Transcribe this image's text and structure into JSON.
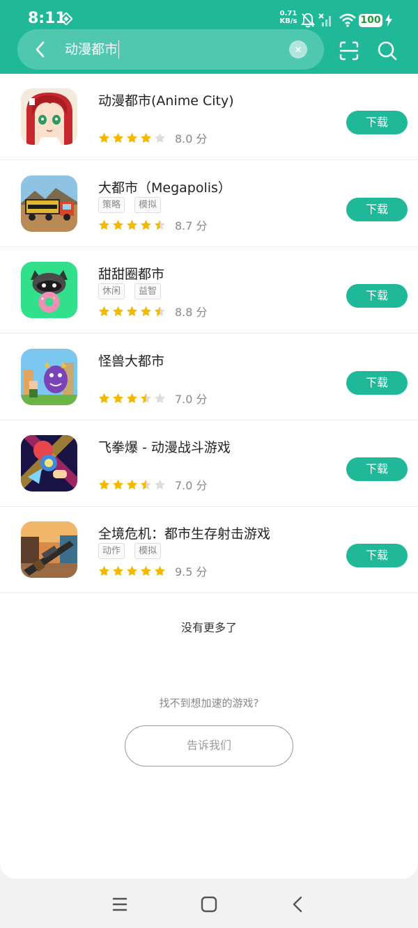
{
  "status": {
    "time": "8:11",
    "speed_value": "0.71",
    "speed_unit": "KB/s",
    "battery": "100"
  },
  "search": {
    "query": "动漫都市"
  },
  "apps": [
    {
      "name": "动漫都市(Anime City)",
      "tags": [],
      "rating": 4,
      "score": "8.0 分",
      "download_label": "下载",
      "icon": "anime-girl-icon"
    },
    {
      "name": "大都市（Megapolis）",
      "tags": [
        "策略",
        "模拟"
      ],
      "rating": 4.5,
      "score": "8.7 分",
      "download_label": "下载",
      "icon": "megapolis-truck-icon"
    },
    {
      "name": "甜甜圈都市",
      "tags": [
        "休闲",
        "益智"
      ],
      "rating": 4.5,
      "score": "8.8 分",
      "download_label": "下载",
      "icon": "raccoon-donut-icon"
    },
    {
      "name": "怪兽大都市",
      "tags": [],
      "rating": 3.5,
      "score": "7.0 分",
      "download_label": "下载",
      "icon": "monster-city-icon"
    },
    {
      "name": "飞拳爆 - 动漫战斗游戏",
      "tags": [],
      "rating": 3.5,
      "score": "7.0 分",
      "download_label": "下载",
      "icon": "flying-fist-icon"
    },
    {
      "name": "全境危机：都市生存射击游戏",
      "tags": [
        "动作",
        "模拟"
      ],
      "rating": 5,
      "score": "9.5 分",
      "download_label": "下载",
      "icon": "rifle-shooter-icon"
    }
  ],
  "footer": {
    "no_more": "没有更多了",
    "cant_find": "找不到想加速的游戏?",
    "tell_us": "告诉我们"
  },
  "colors": {
    "accent": "#1fb99a",
    "star": "#f5b800",
    "star_empty": "#dddddd"
  }
}
